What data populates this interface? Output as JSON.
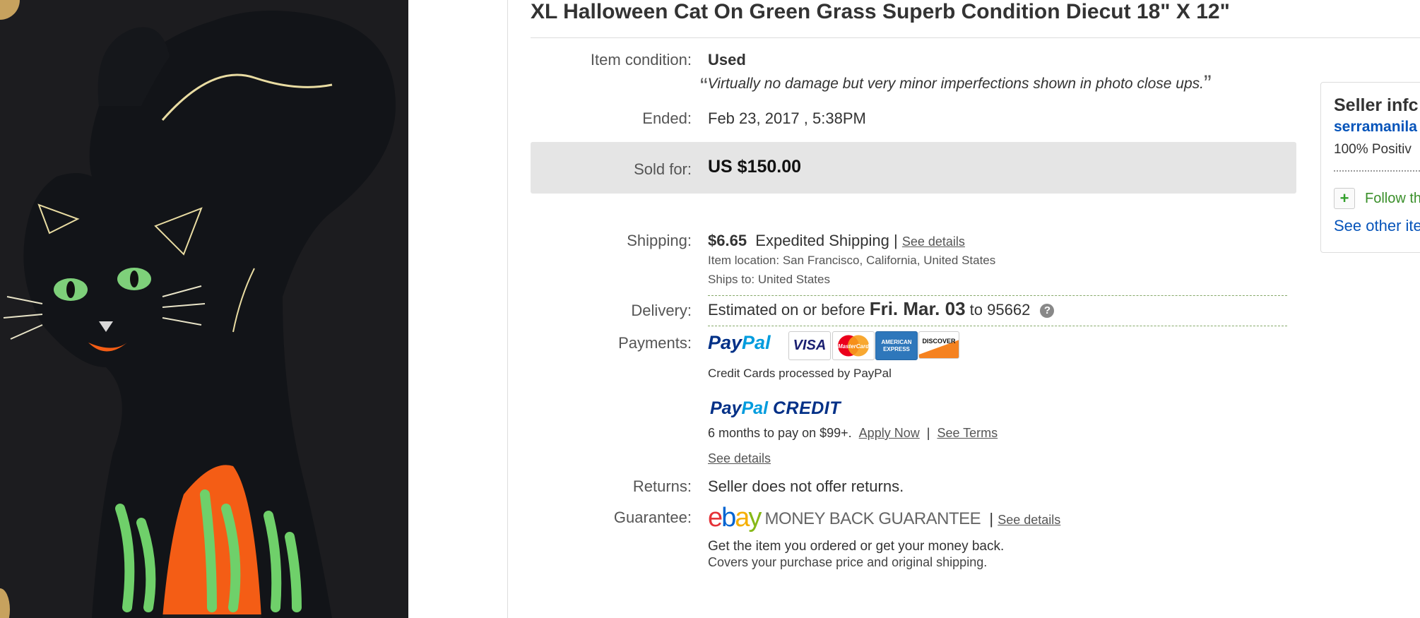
{
  "listing": {
    "title": "XL Halloween Cat On Green Grass Superb Condition Diecut 18\" X 12\""
  },
  "condition": {
    "label": "Item condition:",
    "value": "Used",
    "note": "Virtually no damage but very minor imperfections shown in photo close ups.",
    "open_quote": "“",
    "close_quote": "”"
  },
  "ended": {
    "label": "Ended:",
    "value": "Feb 23, 2017 , 5:38PM"
  },
  "sold": {
    "label": "Sold for:",
    "value": "US $150.00"
  },
  "shipping": {
    "label": "Shipping:",
    "price": "$6.65",
    "service": "Expedited Shipping",
    "separator": "|",
    "details_link": "See details",
    "location_label": "Item location:",
    "location_value": "San Francisco, California, United States",
    "ships_to_label": "Ships to:",
    "ships_to_value": "United States"
  },
  "delivery": {
    "label": "Delivery:",
    "prefix": "Estimated on or before",
    "date": "Fri. Mar. 03",
    "to_text": "to",
    "zip": "95662",
    "help_icon": "?"
  },
  "payments": {
    "label": "Payments:",
    "paypal_pay": "Pay",
    "paypal_pal": "Pal",
    "cards": [
      "VISA",
      "MasterCard",
      "AMERICAN EXPRESS",
      "DISCOVER"
    ],
    "processed_text": "Credit Cards processed by PayPal",
    "credit_pay": "Pay",
    "credit_pal": "Pal",
    "credit_word": "CREDIT",
    "credit_terms": "6 months to pay on $99+.",
    "apply_link": "Apply Now",
    "separator": "|",
    "terms_link": "See Terms",
    "details_link": "See details"
  },
  "returns": {
    "label": "Returns:",
    "value": "Seller does not offer returns."
  },
  "guarantee": {
    "label": "Guarantee:",
    "ebay_e": "e",
    "ebay_b": "b",
    "ebay_a": "a",
    "ebay_y": "y",
    "mbg_text": "MONEY BACK GUARANTEE",
    "separator": "|",
    "details_link": "See details",
    "line1": "Get the item you ordered or get your money back.",
    "line2": "Covers your purchase price and original shipping."
  },
  "seller": {
    "heading": "Seller infc",
    "username": "serramanila",
    "feedback": "100% Positiv",
    "follow_text": "Follow th",
    "other_items": "See other ite"
  },
  "colors": {
    "link_blue": "#0654ba",
    "paypal_dark": "#003087",
    "paypal_light": "#009cde",
    "ebay_red": "#e53238",
    "ebay_blue": "#0064d2",
    "ebay_yellow": "#f5af02",
    "ebay_green": "#86b817",
    "follow_green": "#3a8f2a"
  }
}
